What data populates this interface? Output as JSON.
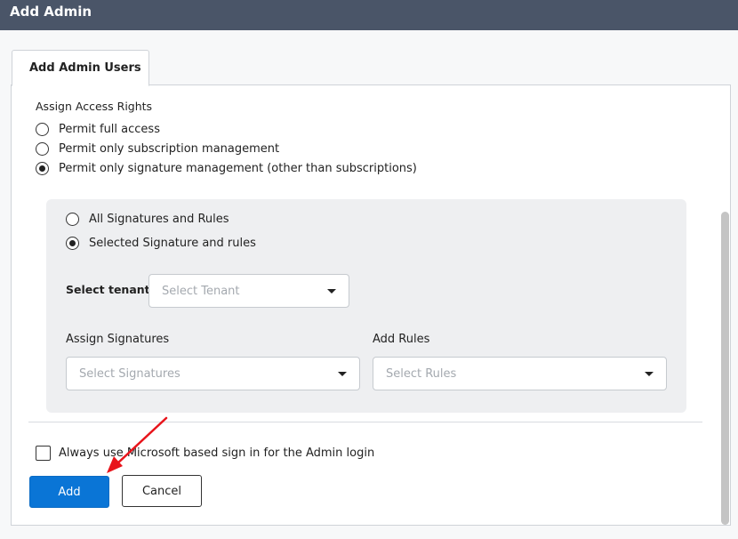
{
  "window": {
    "title": "Add Admin"
  },
  "tabs": [
    {
      "label": "Add Admin Users"
    }
  ],
  "access_rights": {
    "heading": "Assign Access Rights",
    "options": [
      {
        "label": "Permit full access",
        "checked": false
      },
      {
        "label": "Permit only subscription management",
        "checked": false
      },
      {
        "label": "Permit only signature management (other than subscriptions)",
        "checked": true
      }
    ]
  },
  "signature_scope": {
    "options": [
      {
        "label": "All Signatures and Rules",
        "checked": false
      },
      {
        "label": "Selected Signature and rules",
        "checked": true
      }
    ],
    "tenant": {
      "label": "Select tenant",
      "placeholder": "Select Tenant"
    },
    "signatures": {
      "label": "Assign Signatures",
      "placeholder": "Select Signatures"
    },
    "rules": {
      "label": "Add Rules",
      "placeholder": "Select Rules"
    }
  },
  "microsoft_signin": {
    "label": "Always use Microsoft based sign in for the Admin login",
    "checked": false
  },
  "actions": {
    "add_label": "Add",
    "cancel_label": "Cancel"
  },
  "colors": {
    "titlebar": "#4a5568",
    "primary": "#0a75d6",
    "annotation_arrow": "#e8141b"
  },
  "annotation": {
    "icon": "red-arrow-icon"
  }
}
